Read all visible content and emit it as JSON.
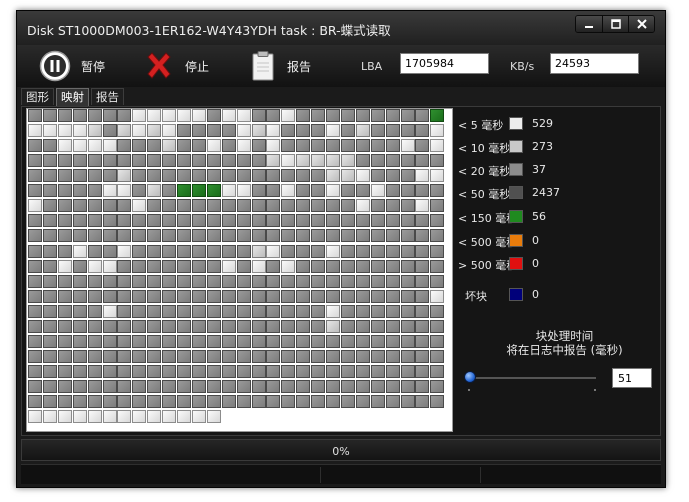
{
  "window": {
    "title": "Disk ST1000DM003-1ER162-W4Y43YDH    task : BR-蝶式读取"
  },
  "toolbar": {
    "pause_label": "暂停",
    "stop_label": "停止",
    "report_label": "报告",
    "lba_label": "LBA",
    "lba_value": "1705984",
    "speed_label": "KB/s",
    "speed_value": "24593"
  },
  "tabs": [
    {
      "label": "图形",
      "active": false
    },
    {
      "label": "映射",
      "active": true
    },
    {
      "label": "报告",
      "active": false
    }
  ],
  "map": {
    "columns": 28,
    "rows_full": 20,
    "last_row_cells": 13,
    "rows": [
      "2222222000002002202222222224",
      "0000121010222201022202122220",
      "2200002221220202022222222020",
      "2222222222222222101111222222",
      "2222221222222222222211022200",
      "2222200212444002202202202222",
      "0222222022222222222222022202",
      "2222222222222222222222222222",
      "2222222222222222222222222222",
      "2220220222222221022202222222",
      "2202002222222020202222222222",
      "2222222222222222222222222222",
      "2222222222222222222222222220",
      "2222202222222222222202222222",
      "2222222222222222222212222222",
      "2222222222222222222222222222",
      "2222222222222222222222222222",
      "2222222222222222222222222222",
      "2222222222222222222222222222",
      "2222222222222222222222222222",
      "0000000000000"
    ]
  },
  "legend": [
    {
      "label": "< 5 毫秒",
      "count": "529",
      "color": "#ededed"
    },
    {
      "label": "< 10 毫秒",
      "count": "273",
      "color": "#c8c8c8"
    },
    {
      "label": "< 20 毫秒",
      "count": "37",
      "color": "#8c8c8c"
    },
    {
      "label": "< 50 毫秒",
      "count": "2437",
      "color": "#505050"
    },
    {
      "label": "< 150 毫秒",
      "count": "56",
      "color": "#1f8a1f"
    },
    {
      "label": "< 500 毫秒",
      "count": "0",
      "color": "#e87c0c"
    },
    {
      "label": "> 500 毫秒",
      "count": "0",
      "color": "#e01010"
    },
    {
      "label": "坏块",
      "count": "0",
      "color": "#00007a"
    }
  ],
  "block_note": {
    "line1": "块处理时间",
    "line2": "将在日志中报告 (毫秒)"
  },
  "slider": {
    "value": "51"
  },
  "progress": {
    "text": "0%",
    "fraction": 0
  }
}
